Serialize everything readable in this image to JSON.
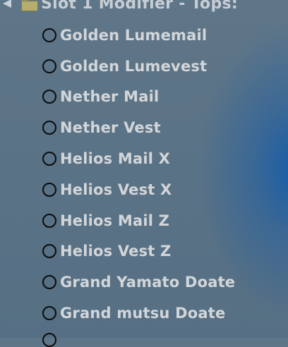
{
  "header": {
    "title": "Slot 1 Modifier - Tops:",
    "arrow_icon": "collapse-arrow-icon",
    "folder_icon": "folder-icon"
  },
  "options": [
    {
      "label": "Golden Lumemail"
    },
    {
      "label": "Golden Lumevest"
    },
    {
      "label": "Nether Mail"
    },
    {
      "label": "Nether Vest"
    },
    {
      "label": "Helios Mail X"
    },
    {
      "label": "Helios Vest X"
    },
    {
      "label": "Helios Mail Z"
    },
    {
      "label": "Helios Vest Z"
    },
    {
      "label": "Grand Yamato Doate"
    },
    {
      "label": "Grand mutsu Doate"
    }
  ],
  "colors": {
    "background": "#5b7386",
    "accent_glow": "#145caa",
    "label_text": "#d3d6d9",
    "radio_border": "#0a0c0e"
  }
}
